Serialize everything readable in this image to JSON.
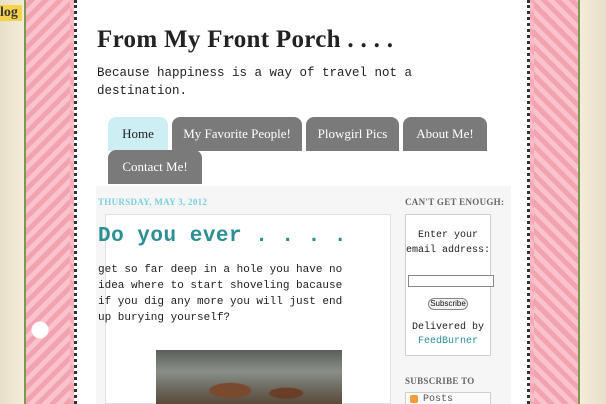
{
  "blog_tag": "log",
  "site": {
    "title": "From My Front Porch . . . .",
    "description": "Because happiness is a way of travel not a destination."
  },
  "nav": {
    "tabs": [
      {
        "label": "Home",
        "active": true
      },
      {
        "label": "My Favorite People!",
        "active": false
      },
      {
        "label": "Plowgirl Pics",
        "active": false
      },
      {
        "label": "About Me!",
        "active": false
      },
      {
        "label": "Contact Me!",
        "active": false
      }
    ]
  },
  "post": {
    "date": "THURSDAY, MAY 3, 2012",
    "title": "Do you ever . . . .",
    "body": "get so far deep in a hole you have no idea where to start shoveling bacause if you dig any more you will just end up burying yourself?"
  },
  "sidebar": {
    "cant_get_enough": "CAN'T GET ENOUGH:",
    "email_prompt": "Enter your email address:",
    "subscribe_button": "Subscribe",
    "delivered_by": "Delivered by",
    "feedburner": "FeedBurner",
    "subscribe_to": "SUBSCRIBE TO",
    "posts_label": "Posts"
  },
  "colors": {
    "accent": "#2b8f94",
    "tab_active": "#cdeef3",
    "tab_inactive": "#7a7a7a",
    "date": "#7ad1de"
  }
}
